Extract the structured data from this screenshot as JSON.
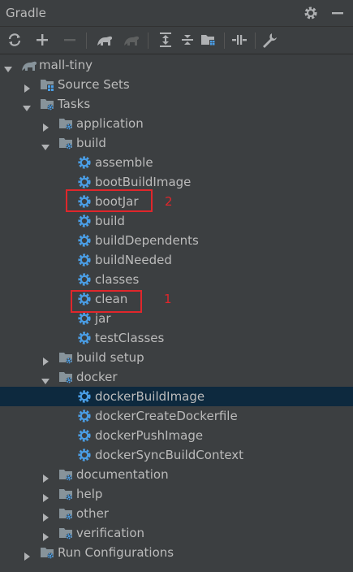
{
  "panel": {
    "title": "Gradle"
  },
  "tree": {
    "root": {
      "label": "mall-tiny"
    },
    "source_sets": {
      "label": "Source Sets"
    },
    "tasks": {
      "label": "Tasks"
    },
    "application": {
      "label": "application"
    },
    "build": {
      "label": "build",
      "tasks": [
        "assemble",
        "bootBuildImage",
        "bootJar",
        "build",
        "buildDependents",
        "buildNeeded",
        "classes",
        "clean",
        "jar",
        "testClasses"
      ]
    },
    "build_setup": {
      "label": "build setup"
    },
    "docker": {
      "label": "docker",
      "tasks": [
        "dockerBuildImage",
        "dockerCreateDockerfile",
        "dockerPushImage",
        "dockerSyncBuildContext"
      ]
    },
    "documentation": {
      "label": "documentation"
    },
    "help": {
      "label": "help"
    },
    "other": {
      "label": "other"
    },
    "verification": {
      "label": "verification"
    },
    "run_configurations": {
      "label": "Run Configurations"
    }
  },
  "annotations": [
    {
      "label": "2",
      "target": "bootJar"
    },
    {
      "label": "1",
      "target": "clean"
    }
  ],
  "colors": {
    "background": "#3c3f41",
    "selection": "#0d293e",
    "text": "#bbbbbb",
    "gear": "#4a9ee6",
    "annotation": "#e0262b"
  }
}
